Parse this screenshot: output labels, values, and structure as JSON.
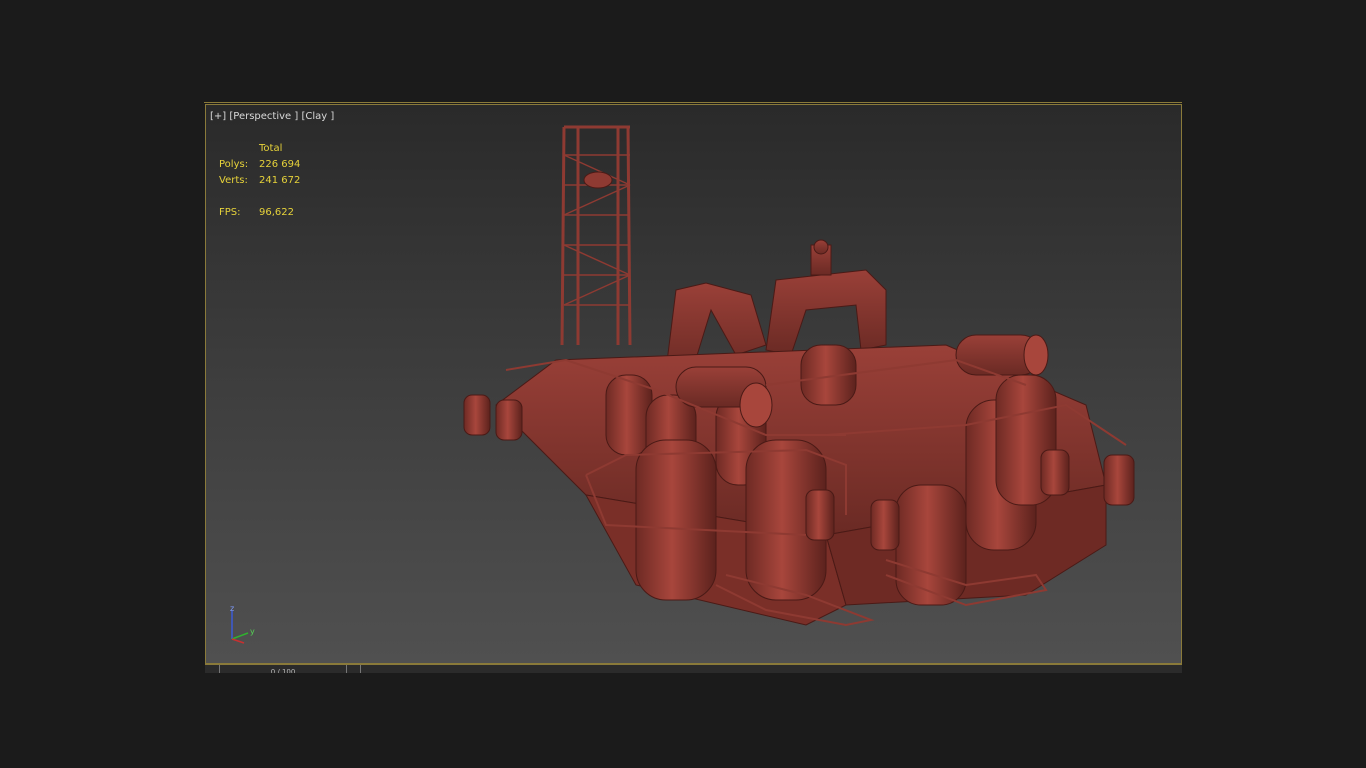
{
  "viewport": {
    "label_plus": "[+]",
    "label_view": "[Perspective ]",
    "label_shading": "[Clay ]"
  },
  "stats": {
    "header": "Total",
    "polys_label": "Polys:",
    "polys_value": "226 694",
    "verts_label": "Verts:",
    "verts_value": "241 672",
    "fps_label": "FPS:",
    "fps_value": "96,622"
  },
  "axis_gizmo": {
    "z": "z",
    "y": "y"
  },
  "timeline": {
    "slider_text": "0 / 100"
  },
  "colors": {
    "model": "#8e3a32",
    "stats_text": "#e6d23a",
    "viewport_border": "#8a7a3a"
  }
}
